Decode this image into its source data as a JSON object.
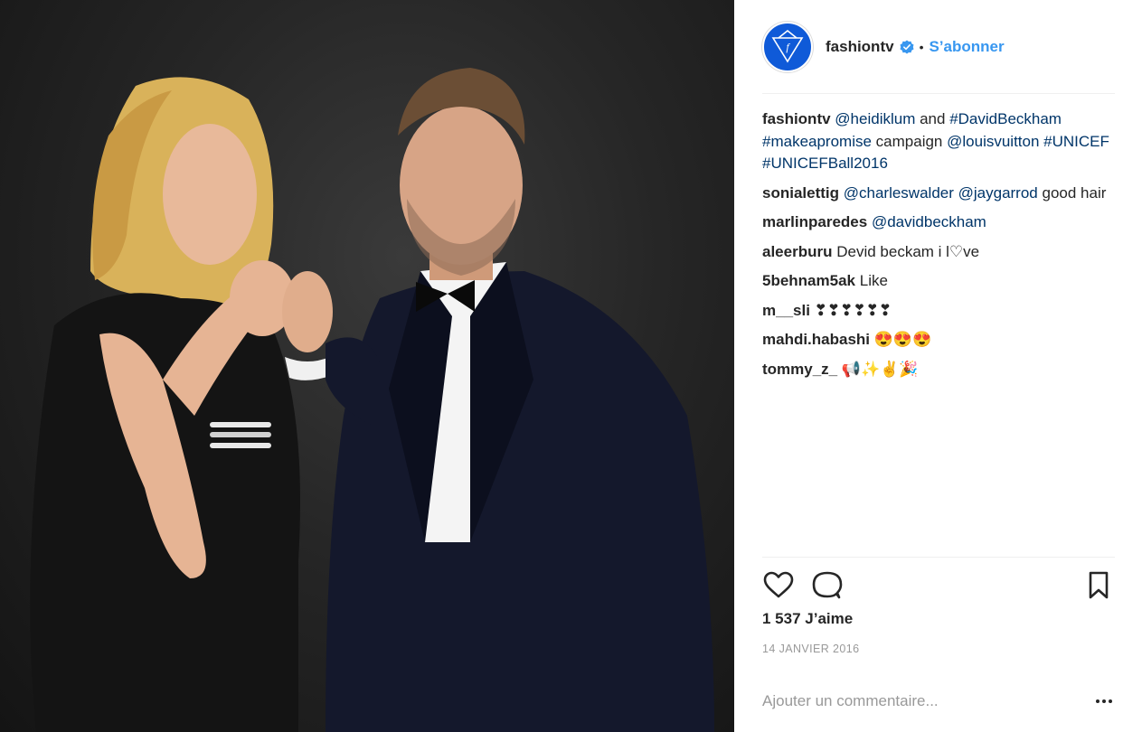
{
  "post": {
    "author": "fashiontv",
    "follow_label": "S’abonner",
    "likes": "1 537 J’aime",
    "date": "14 JANVIER 2016",
    "comment_placeholder": "Ajouter un commentaire..."
  },
  "caption": {
    "user": "fashiontv",
    "mention1": "@heidiklum",
    "and": " and ",
    "tag1": "#DavidBeckham",
    "tag2": "#makeapromise",
    "campaign": " campaign ",
    "mention2": "@louisvuitton",
    "tag3": "#UNICEF",
    "tag4": "#UNICEFBall2016"
  },
  "comments": [
    {
      "user": "sonialettig",
      "mention1": "@charleswalder",
      "mention2": "@jaygarrod",
      "text": "good hair"
    },
    {
      "user": "marlinparedes",
      "mention": "@davidbeckham"
    },
    {
      "user": "aleerburu",
      "text": "Devid beckam i l♡ve"
    },
    {
      "user": "5behnam5ak",
      "text": "Like"
    },
    {
      "user": "m__sli",
      "text": "❣❣❣❣❣❣"
    },
    {
      "user": "mahdi.habashi",
      "text": "😍😍😍"
    },
    {
      "user": "tommy_z_",
      "text": "📢✨✌🎉"
    }
  ],
  "colors": {
    "accent": "#3897f0",
    "link": "#003569",
    "avatar_bg": "#0f5ad8"
  },
  "icons": [
    "verified-icon",
    "heart-icon",
    "comment-icon",
    "bookmark-icon",
    "more-icon"
  ]
}
